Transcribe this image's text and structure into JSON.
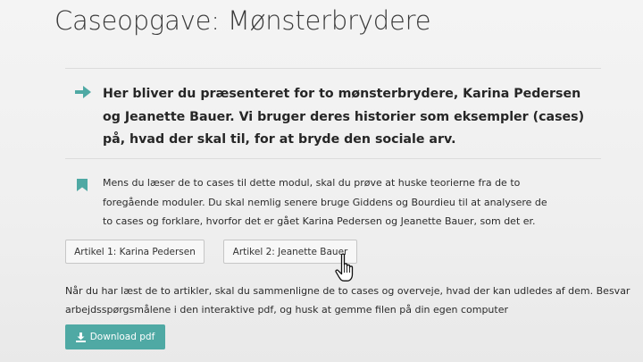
{
  "page": {
    "title": "Caseopgave: Mønsterbrydere"
  },
  "intro": {
    "icon": "arrow-right-icon",
    "text": "Her bliver du præsenteret for to mønsterbrydere, Karina Pedersen og Jeanette Bauer. Vi bruger deres historier som eksempler (cases) på, hvad der skal til, for at bryde den sociale arv."
  },
  "note": {
    "icon": "bookmark-icon",
    "text": "Mens du læser de to cases til dette modul, skal du prøve at huske teorierne fra de to foregående moduler. Du skal nemlig senere bruge Giddens og Bourdieu til at analysere de to cases og forklare, hvorfor det er gået Karina Pedersen og Jeanette Bauer, som det er."
  },
  "articles": [
    {
      "label": "Artikel 1: Karina Pedersen"
    },
    {
      "label": "Artikel 2: Jeanette Bauer"
    }
  ],
  "instructions": {
    "text": "Når du har læst de to artikler, skal du sammenligne de to cases og overveje, hvad der kan udledes af dem. Besvar arbejdsspørgsmålene i den interaktive pdf, og husk at gemme filen på din egen computer"
  },
  "download": {
    "label": "Download pdf",
    "icon": "download-icon"
  },
  "colors": {
    "accent": "#4fa9a4",
    "background": "#f1f1f1",
    "text": "#2e2e2e"
  }
}
